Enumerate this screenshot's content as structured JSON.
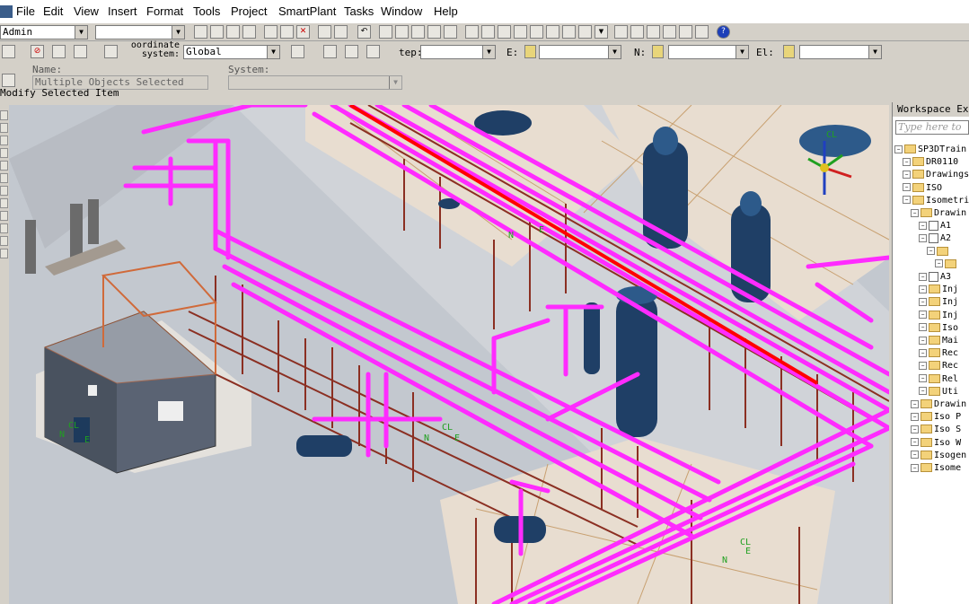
{
  "menu": [
    "File",
    "Edit",
    "View",
    "Insert",
    "Format",
    "Tools",
    "Project",
    "SmartPlant",
    "Tasks",
    "Window",
    "Help"
  ],
  "toolbar": {
    "permission_group": "Admin",
    "coordinate_system_label": "oordinate system:",
    "coordinate_system_value": "Global",
    "step_label": "tep:",
    "e_label": "E:",
    "n_label": "N:",
    "el_label": "El:",
    "name_label": "Name:",
    "name_value": "Multiple Objects Selected",
    "system_label": "System:",
    "status": "Modify Selected Item"
  },
  "explorer": {
    "title": "Workspace Exp",
    "search_placeholder": "Type here to",
    "items": [
      {
        "label": "SP3DTrain",
        "type": "root",
        "indent": 0
      },
      {
        "label": "DR0110",
        "type": "folder",
        "indent": 1
      },
      {
        "label": "Drawings",
        "type": "folder",
        "indent": 1
      },
      {
        "label": "ISO",
        "type": "folder",
        "indent": 1
      },
      {
        "label": "Isometric",
        "type": "folder",
        "indent": 1
      },
      {
        "label": "Drawin",
        "type": "folder",
        "indent": 2
      },
      {
        "label": "A1",
        "type": "doc",
        "indent": 3
      },
      {
        "label": "A2",
        "type": "doc",
        "indent": 3
      },
      {
        "label": "",
        "type": "folder",
        "indent": 4
      },
      {
        "label": "",
        "type": "folder",
        "indent": 5
      },
      {
        "label": "A3",
        "type": "doc",
        "indent": 3
      },
      {
        "label": "Inj",
        "type": "folder",
        "indent": 3
      },
      {
        "label": "Inj",
        "type": "folder",
        "indent": 3
      },
      {
        "label": "Inj",
        "type": "folder",
        "indent": 3
      },
      {
        "label": "Iso",
        "type": "folder",
        "indent": 3
      },
      {
        "label": "Mai",
        "type": "folder",
        "indent": 3
      },
      {
        "label": "Rec",
        "type": "folder",
        "indent": 3
      },
      {
        "label": "Rec",
        "type": "folder",
        "indent": 3
      },
      {
        "label": "Rel",
        "type": "folder",
        "indent": 3
      },
      {
        "label": "Uti",
        "type": "folder",
        "indent": 3
      },
      {
        "label": "Drawin",
        "type": "folder",
        "indent": 2
      },
      {
        "label": "Iso P",
        "type": "folder",
        "indent": 2
      },
      {
        "label": "Iso S",
        "type": "folder",
        "indent": 2
      },
      {
        "label": "Iso W",
        "type": "folder",
        "indent": 2
      },
      {
        "label": "Isogen",
        "type": "folder",
        "indent": 2
      },
      {
        "label": "Isome",
        "type": "folder",
        "indent": 2
      }
    ]
  },
  "view_labels": [
    "N",
    "E",
    "CL",
    "N",
    "E",
    "CL",
    "N",
    "E",
    "CL",
    "N",
    "E",
    "CL"
  ],
  "colors": {
    "pipe": "#ff2bff",
    "pipe_dark": "#cc00cc",
    "steel": "#8b2f22",
    "slab": "#e5d9c8",
    "vessel": "#1f3f66",
    "ground": "#c3c8cf",
    "highlight": "#ff0000"
  }
}
